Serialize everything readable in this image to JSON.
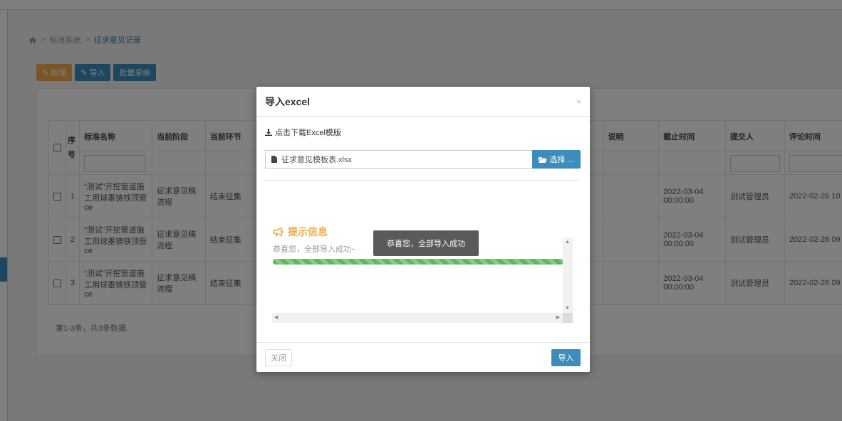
{
  "breadcrumb": {
    "home_icon": "home-icon",
    "sep": ">",
    "level1": "标准系统",
    "current": "征求意见记录"
  },
  "toolbar": {
    "add_label": "新增",
    "import_label": "导入",
    "batch_label": "批量采纳"
  },
  "table": {
    "headers": {
      "seq": "序号",
      "name": "标准名称",
      "stage": "当前阶段",
      "step": "当前环节",
      "desc": "说明",
      "deadline": "截止时间",
      "submitter": "提交人",
      "comment_time": "评论时间"
    },
    "rows": [
      {
        "seq": "1",
        "name": "“测试”开挖管道施工用球墨铸铁顶管ce",
        "stage": "征求意见稿流程",
        "step": "结束征集",
        "deadline": "2022-03-04 00:00:00",
        "submitter": "测试管理员",
        "comment_time": "2022-02-26 10"
      },
      {
        "seq": "2",
        "name": "“测试”开挖管道施工用球墨铸铁顶管ce",
        "stage": "征求意见稿流程",
        "step": "结束征集",
        "deadline": "2022-03-04 00:00:00",
        "submitter": "测试管理员",
        "comment_time": "2022-02-26 09"
      },
      {
        "seq": "3",
        "name": "“测试”开挖管道施工用球墨铸铁顶管ce",
        "stage": "征求意见稿流程",
        "step": "结束征集",
        "deadline": "2022-03-04 00:00:00",
        "submitter": "测试管理员",
        "comment_time": "2022-02-26 09"
      }
    ],
    "summary": "第1-3条，共3条数据."
  },
  "modal": {
    "title": "导入excel",
    "close_symbol": "×",
    "download_label": "点击下载Excel模版",
    "file_name": "征求意见模板表.xlsx",
    "choose_label": "选择 ...",
    "notice_title": "提示信息",
    "notice_message": "恭喜您，全部导入成功~",
    "progress_percent": 100,
    "toast": "恭喜您，全部导入成功",
    "close_label": "关闭",
    "import_label": "导入"
  },
  "colors": {
    "primary": "#3c8dbc",
    "warning": "#f0ad4e",
    "success": "#5cb85c"
  }
}
